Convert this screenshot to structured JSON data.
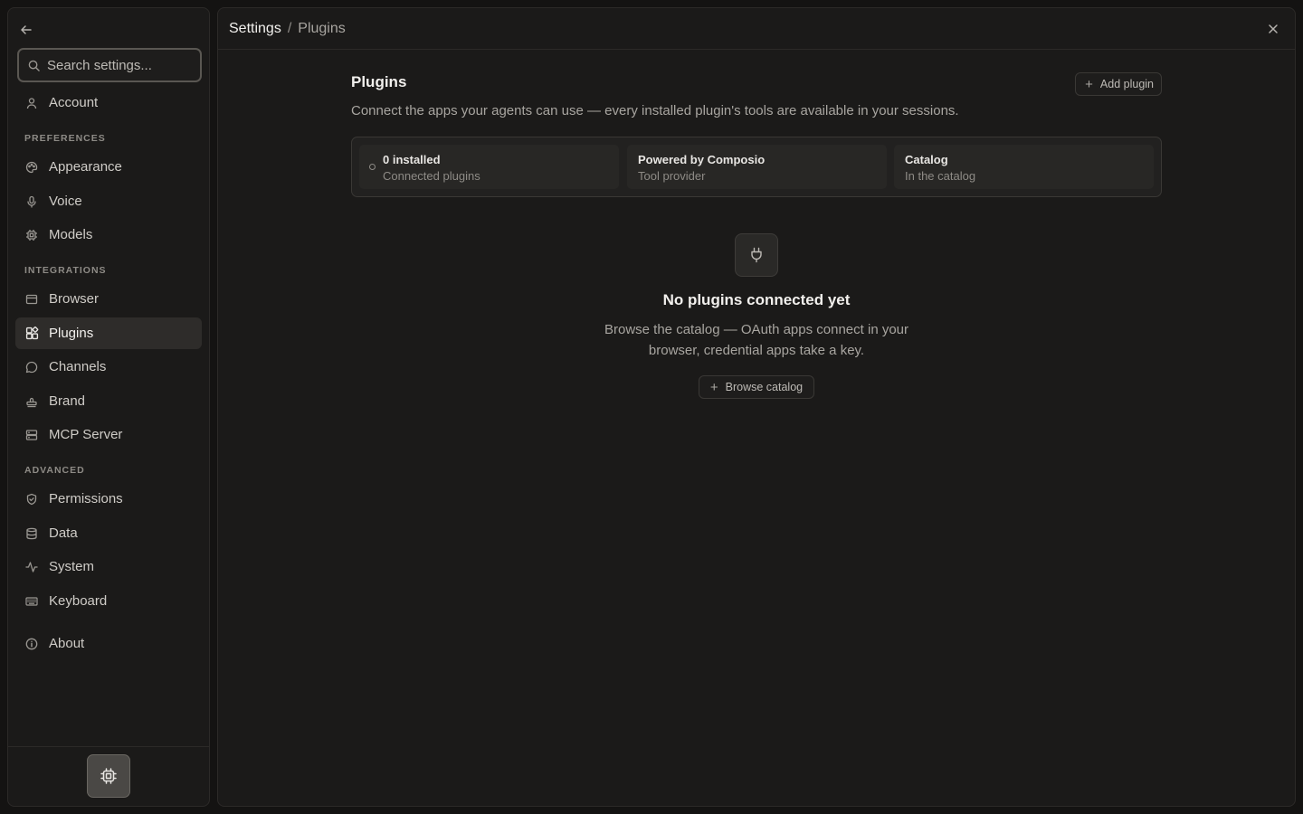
{
  "sidebar": {
    "search_placeholder": "Search settings...",
    "sections": {
      "preferences": "PREFERENCES",
      "integrations": "INTEGRATIONS",
      "advanced": "ADVANCED"
    },
    "items": {
      "account": "Account",
      "appearance": "Appearance",
      "voice": "Voice",
      "models": "Models",
      "browser": "Browser",
      "plugins": "Plugins",
      "channels": "Channels",
      "brand": "Brand",
      "mcp_server": "MCP Server",
      "permissions": "Permissions",
      "data": "Data",
      "system": "System",
      "keyboard": "Keyboard",
      "about": "About"
    },
    "active_item": "plugins"
  },
  "breadcrumb": {
    "root": "Settings",
    "separator": "/",
    "current": "Plugins"
  },
  "page": {
    "title": "Plugins",
    "description": "Connect the apps your agents can use — every installed plugin's tools are available in your sessions.",
    "add_button": "Add plugin"
  },
  "stats": [
    {
      "title": "0 installed",
      "subtitle": "Connected plugins"
    },
    {
      "title": "Powered by Composio",
      "subtitle": "Tool provider"
    },
    {
      "title": "Catalog",
      "subtitle": "In the catalog"
    }
  ],
  "empty_state": {
    "title": "No plugins connected yet",
    "description": "Browse the catalog — OAuth apps connect in your browser, credential apps take a key.",
    "button": "Browse catalog"
  },
  "colors": {
    "background": "#141312",
    "panel": "#1b1a19",
    "active_item": "#2e2c2a",
    "text_primary": "#f2f0ed",
    "text_muted": "#a8a5a0"
  }
}
